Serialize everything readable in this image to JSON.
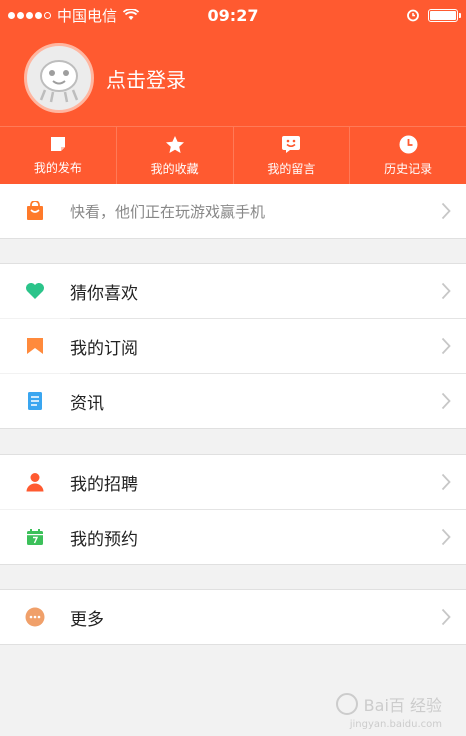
{
  "status": {
    "carrier": "中国电信",
    "time": "09:27",
    "icons": [
      "signal-dots",
      "wifi-icon",
      "alarm-icon",
      "battery-icon"
    ],
    "battery_level": 1.0
  },
  "header": {
    "login_text": "点击登录",
    "avatar_icon": "mascot-avatar-icon",
    "bg_color": "#ff5a30"
  },
  "quick_tabs": [
    {
      "label": "我的发布",
      "icon": "note-icon"
    },
    {
      "label": "我的收藏",
      "icon": "star-icon"
    },
    {
      "label": "我的留言",
      "icon": "smile-message-icon"
    },
    {
      "label": "历史记录",
      "icon": "clock-icon"
    }
  ],
  "notice": {
    "text": "快看，他们正在玩游戏赢手机",
    "icon": "shopping-bag-icon"
  },
  "group1": [
    {
      "label": "猜你喜欢",
      "icon": "heart-icon",
      "color": "#2bc48a"
    },
    {
      "label": "我的订阅",
      "icon": "bookmark-icon",
      "color": "#ff8a3c"
    },
    {
      "label": "资讯",
      "icon": "document-icon",
      "color": "#3aa6f0"
    }
  ],
  "group2": [
    {
      "label": "我的招聘",
      "icon": "person-icon",
      "color": "#ff5a30"
    },
    {
      "label": "我的预约",
      "icon": "calendar-icon",
      "color": "#3cc05a"
    }
  ],
  "group3": [
    {
      "label": "更多",
      "icon": "more-dots-icon",
      "color": "#f0a06a"
    }
  ],
  "watermark": {
    "text": "Bai百 经验",
    "sub": "jingyan.baidu.com"
  }
}
